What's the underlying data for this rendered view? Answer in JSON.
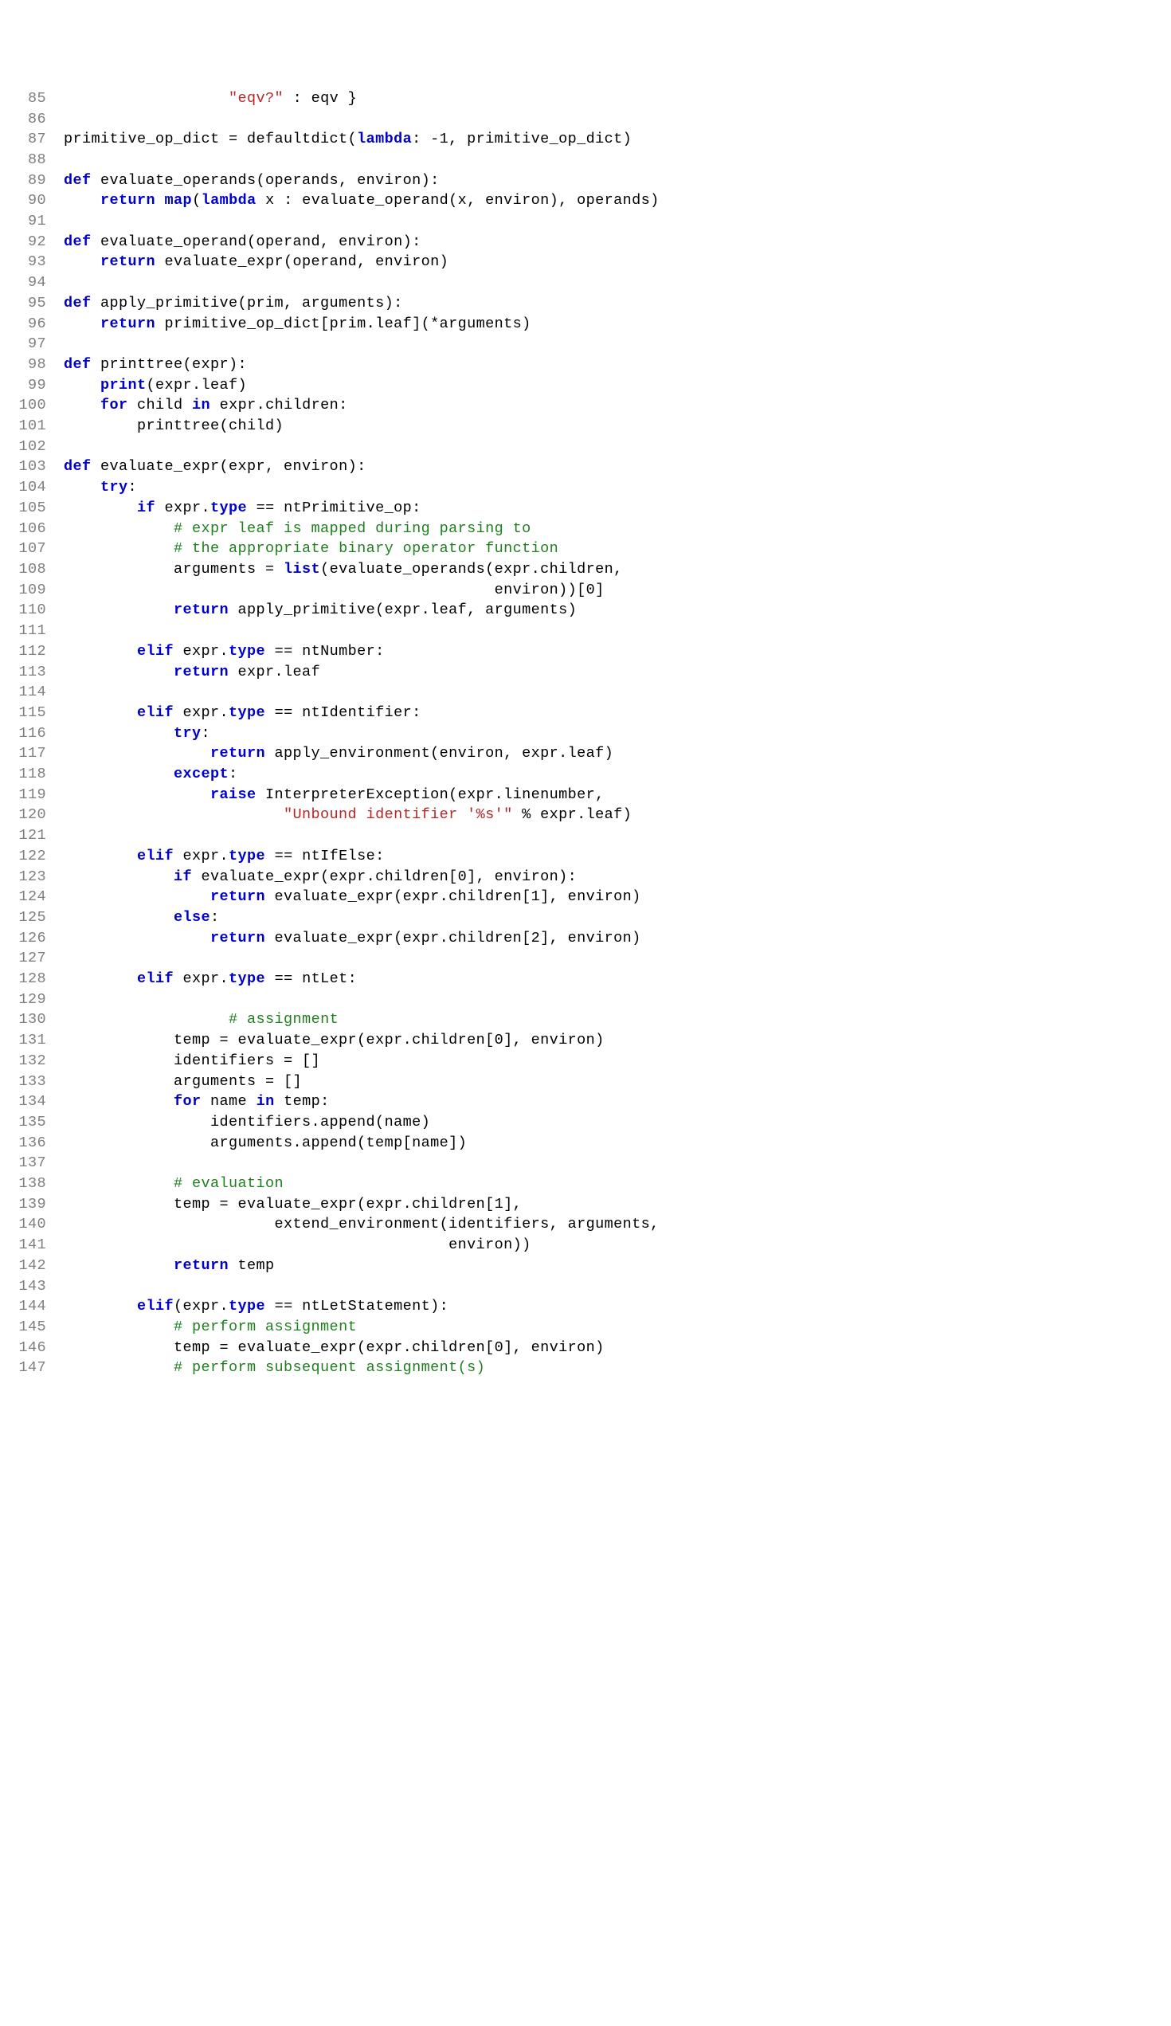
{
  "lines": [
    {
      "n": 85,
      "tokens": [
        {
          "t": "                  "
        },
        {
          "t": "\"eqv?\"",
          "c": "str"
        },
        {
          "t": " : eqv }"
        }
      ]
    },
    {
      "n": 86,
      "tokens": []
    },
    {
      "n": 87,
      "tokens": [
        {
          "t": "primitive_op_dict = defaultdict("
        },
        {
          "t": "lambda",
          "c": "kw"
        },
        {
          "t": ": -1, primitive_op_dict)"
        }
      ]
    },
    {
      "n": 88,
      "tokens": []
    },
    {
      "n": 89,
      "tokens": [
        {
          "t": "def",
          "c": "kw"
        },
        {
          "t": " evaluate_operands(operands, environ):"
        }
      ]
    },
    {
      "n": 90,
      "tokens": [
        {
          "t": "    "
        },
        {
          "t": "return",
          "c": "kw"
        },
        {
          "t": " "
        },
        {
          "t": "map",
          "c": "ty"
        },
        {
          "t": "("
        },
        {
          "t": "lambda",
          "c": "kw"
        },
        {
          "t": " x : evaluate_operand(x, environ), operands)"
        }
      ]
    },
    {
      "n": 91,
      "tokens": []
    },
    {
      "n": 92,
      "tokens": [
        {
          "t": "def",
          "c": "kw"
        },
        {
          "t": " evaluate_operand(operand, environ):"
        }
      ]
    },
    {
      "n": 93,
      "tokens": [
        {
          "t": "    "
        },
        {
          "t": "return",
          "c": "kw"
        },
        {
          "t": " evaluate_expr(operand, environ)"
        }
      ]
    },
    {
      "n": 94,
      "tokens": []
    },
    {
      "n": 95,
      "tokens": [
        {
          "t": "def",
          "c": "kw"
        },
        {
          "t": " apply_primitive(prim, arguments):"
        }
      ]
    },
    {
      "n": 96,
      "tokens": [
        {
          "t": "    "
        },
        {
          "t": "return",
          "c": "kw"
        },
        {
          "t": " primitive_op_dict[prim.leaf](*arguments)"
        }
      ]
    },
    {
      "n": 97,
      "tokens": []
    },
    {
      "n": 98,
      "tokens": [
        {
          "t": "def",
          "c": "kw"
        },
        {
          "t": " printtree(expr):"
        }
      ]
    },
    {
      "n": 99,
      "tokens": [
        {
          "t": "    "
        },
        {
          "t": "print",
          "c": "kw"
        },
        {
          "t": "(expr.leaf)"
        }
      ]
    },
    {
      "n": 100,
      "tokens": [
        {
          "t": "    "
        },
        {
          "t": "for",
          "c": "kw"
        },
        {
          "t": " child "
        },
        {
          "t": "in",
          "c": "kw"
        },
        {
          "t": " expr.children:"
        }
      ]
    },
    {
      "n": 101,
      "tokens": [
        {
          "t": "        printtree(child)"
        }
      ]
    },
    {
      "n": 102,
      "tokens": []
    },
    {
      "n": 103,
      "tokens": [
        {
          "t": "def",
          "c": "kw"
        },
        {
          "t": " evaluate_expr(expr, environ):"
        }
      ]
    },
    {
      "n": 104,
      "tokens": [
        {
          "t": "    "
        },
        {
          "t": "try",
          "c": "kw"
        },
        {
          "t": ":"
        }
      ]
    },
    {
      "n": 105,
      "tokens": [
        {
          "t": "        "
        },
        {
          "t": "if",
          "c": "kw"
        },
        {
          "t": " expr."
        },
        {
          "t": "type",
          "c": "ty"
        },
        {
          "t": " == ntPrimitive_op:"
        }
      ]
    },
    {
      "n": 106,
      "tokens": [
        {
          "t": "            "
        },
        {
          "t": "# expr leaf is mapped during parsing to",
          "c": "cm"
        }
      ]
    },
    {
      "n": 107,
      "tokens": [
        {
          "t": "            "
        },
        {
          "t": "# the appropriate binary operator function",
          "c": "cm"
        }
      ]
    },
    {
      "n": 108,
      "tokens": [
        {
          "t": "            arguments = "
        },
        {
          "t": "list",
          "c": "kw"
        },
        {
          "t": "(evaluate_operands(expr.children,"
        }
      ]
    },
    {
      "n": 109,
      "tokens": [
        {
          "t": "                                               environ))[0]"
        }
      ]
    },
    {
      "n": 110,
      "tokens": [
        {
          "t": "            "
        },
        {
          "t": "return",
          "c": "kw"
        },
        {
          "t": " apply_primitive(expr.leaf, arguments)"
        }
      ]
    },
    {
      "n": 111,
      "tokens": []
    },
    {
      "n": 112,
      "tokens": [
        {
          "t": "        "
        },
        {
          "t": "elif",
          "c": "kw"
        },
        {
          "t": " expr."
        },
        {
          "t": "type",
          "c": "ty"
        },
        {
          "t": " == ntNumber:"
        }
      ]
    },
    {
      "n": 113,
      "tokens": [
        {
          "t": "            "
        },
        {
          "t": "return",
          "c": "kw"
        },
        {
          "t": " expr.leaf"
        }
      ]
    },
    {
      "n": 114,
      "tokens": []
    },
    {
      "n": 115,
      "tokens": [
        {
          "t": "        "
        },
        {
          "t": "elif",
          "c": "kw"
        },
        {
          "t": " expr."
        },
        {
          "t": "type",
          "c": "ty"
        },
        {
          "t": " == ntIdentifier:"
        }
      ]
    },
    {
      "n": 116,
      "tokens": [
        {
          "t": "            "
        },
        {
          "t": "try",
          "c": "kw"
        },
        {
          "t": ":"
        }
      ]
    },
    {
      "n": 117,
      "tokens": [
        {
          "t": "                "
        },
        {
          "t": "return",
          "c": "kw"
        },
        {
          "t": " apply_environment(environ, expr.leaf)"
        }
      ]
    },
    {
      "n": 118,
      "tokens": [
        {
          "t": "            "
        },
        {
          "t": "except",
          "c": "kw"
        },
        {
          "t": ":"
        }
      ]
    },
    {
      "n": 119,
      "tokens": [
        {
          "t": "                "
        },
        {
          "t": "raise",
          "c": "kw"
        },
        {
          "t": " InterpreterException(expr.linenumber,"
        }
      ]
    },
    {
      "n": 120,
      "tokens": [
        {
          "t": "                        "
        },
        {
          "t": "\"Unbound identifier '%s'\"",
          "c": "str"
        },
        {
          "t": " % expr.leaf)"
        }
      ]
    },
    {
      "n": 121,
      "tokens": []
    },
    {
      "n": 122,
      "tokens": [
        {
          "t": "        "
        },
        {
          "t": "elif",
          "c": "kw"
        },
        {
          "t": " expr."
        },
        {
          "t": "type",
          "c": "ty"
        },
        {
          "t": " == ntIfElse:"
        }
      ]
    },
    {
      "n": 123,
      "tokens": [
        {
          "t": "            "
        },
        {
          "t": "if",
          "c": "kw"
        },
        {
          "t": " evaluate_expr(expr.children[0], environ):"
        }
      ]
    },
    {
      "n": 124,
      "tokens": [
        {
          "t": "                "
        },
        {
          "t": "return",
          "c": "kw"
        },
        {
          "t": " evaluate_expr(expr.children[1], environ)"
        }
      ]
    },
    {
      "n": 125,
      "tokens": [
        {
          "t": "            "
        },
        {
          "t": "else",
          "c": "kw"
        },
        {
          "t": ":"
        }
      ]
    },
    {
      "n": 126,
      "tokens": [
        {
          "t": "                "
        },
        {
          "t": "return",
          "c": "kw"
        },
        {
          "t": " evaluate_expr(expr.children[2], environ)"
        }
      ]
    },
    {
      "n": 127,
      "tokens": []
    },
    {
      "n": 128,
      "tokens": [
        {
          "t": "        "
        },
        {
          "t": "elif",
          "c": "kw"
        },
        {
          "t": " expr."
        },
        {
          "t": "type",
          "c": "ty"
        },
        {
          "t": " == ntLet:"
        }
      ]
    },
    {
      "n": 129,
      "tokens": []
    },
    {
      "n": 130,
      "tokens": [
        {
          "t": "                  "
        },
        {
          "t": "# assignment",
          "c": "cm"
        }
      ]
    },
    {
      "n": 131,
      "tokens": [
        {
          "t": "            temp = evaluate_expr(expr.children[0], environ)"
        }
      ]
    },
    {
      "n": 132,
      "tokens": [
        {
          "t": "            identifiers = []"
        }
      ]
    },
    {
      "n": 133,
      "tokens": [
        {
          "t": "            arguments = []"
        }
      ]
    },
    {
      "n": 134,
      "tokens": [
        {
          "t": "            "
        },
        {
          "t": "for",
          "c": "kw"
        },
        {
          "t": " name "
        },
        {
          "t": "in",
          "c": "kw"
        },
        {
          "t": " temp:"
        }
      ]
    },
    {
      "n": 135,
      "tokens": [
        {
          "t": "                identifiers.append(name)"
        }
      ]
    },
    {
      "n": 136,
      "tokens": [
        {
          "t": "                arguments.append(temp[name])"
        }
      ]
    },
    {
      "n": 137,
      "tokens": []
    },
    {
      "n": 138,
      "tokens": [
        {
          "t": "            "
        },
        {
          "t": "# evaluation",
          "c": "cm"
        }
      ]
    },
    {
      "n": 139,
      "tokens": [
        {
          "t": "            temp = evaluate_expr(expr.children[1],"
        }
      ]
    },
    {
      "n": 140,
      "tokens": [
        {
          "t": "                       extend_environment(identifiers, arguments,"
        }
      ]
    },
    {
      "n": 141,
      "tokens": [
        {
          "t": "                                          environ))"
        }
      ]
    },
    {
      "n": 142,
      "tokens": [
        {
          "t": "            "
        },
        {
          "t": "return",
          "c": "kw"
        },
        {
          "t": " temp"
        }
      ]
    },
    {
      "n": 143,
      "tokens": []
    },
    {
      "n": 144,
      "tokens": [
        {
          "t": "        "
        },
        {
          "t": "elif",
          "c": "kw"
        },
        {
          "t": "(expr."
        },
        {
          "t": "type",
          "c": "ty"
        },
        {
          "t": " == ntLetStatement):"
        }
      ]
    },
    {
      "n": 145,
      "tokens": [
        {
          "t": "            "
        },
        {
          "t": "# perform assignment",
          "c": "cm"
        }
      ]
    },
    {
      "n": 146,
      "tokens": [
        {
          "t": "            temp = evaluate_expr(expr.children[0], environ)"
        }
      ]
    },
    {
      "n": 147,
      "tokens": [
        {
          "t": "            "
        },
        {
          "t": "# perform subsequent assignment(s)",
          "c": "cm"
        }
      ]
    }
  ]
}
